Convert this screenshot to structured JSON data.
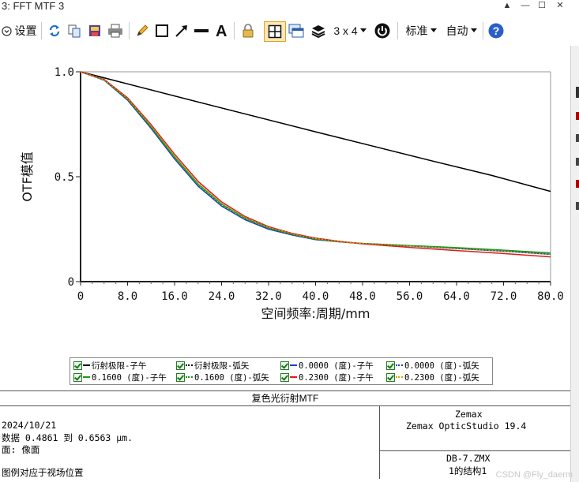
{
  "window": {
    "title": "3: FFT MTF 3",
    "controls": [
      "▲",
      "—",
      "☐",
      "✕"
    ]
  },
  "toolbar": {
    "settings_label": "设置",
    "layout_label": "3 x 4",
    "standard_label": "标准",
    "auto_label": "自动"
  },
  "chart_data": {
    "type": "line",
    "xlabel": "空间频率:周期/mm",
    "ylabel": "OTF模值",
    "xlim": [
      0,
      80
    ],
    "ylim": [
      0,
      1.0
    ],
    "xticks": [
      "0",
      "8.0",
      "16.0",
      "24.0",
      "32.0",
      "40.0",
      "48.0",
      "56.0",
      "64.0",
      "72.0",
      "80.0"
    ],
    "yticks": [
      "0",
      "0.5",
      "1.0"
    ],
    "grid": false,
    "legend_position": "bottom",
    "series": [
      {
        "name": "衍射极限-子午",
        "color": "#000000",
        "dash": "solid",
        "x": [
          0,
          10,
          20,
          30,
          40,
          50,
          60,
          70,
          80
        ],
        "y": [
          1.0,
          0.928,
          0.856,
          0.785,
          0.714,
          0.644,
          0.574,
          0.506,
          0.43
        ]
      },
      {
        "name": "衍射极限-弧矢",
        "color": "#000000",
        "dash": "dotted",
        "x": [
          0,
          10,
          20,
          30,
          40,
          50,
          60,
          70,
          80
        ],
        "y": [
          1.0,
          0.928,
          0.856,
          0.785,
          0.714,
          0.644,
          0.574,
          0.506,
          0.43
        ]
      },
      {
        "name": "0.0000 (度)-子午",
        "color": "#1f3fbf",
        "dash": "solid",
        "x": [
          0,
          4,
          8,
          12,
          16,
          20,
          24,
          28,
          32,
          36,
          40,
          44,
          48,
          56,
          64,
          72,
          80
        ],
        "y": [
          1.0,
          0.96,
          0.865,
          0.73,
          0.585,
          0.455,
          0.36,
          0.295,
          0.25,
          0.222,
          0.2,
          0.19,
          0.182,
          0.17,
          0.158,
          0.145,
          0.13
        ]
      },
      {
        "name": "0.0000 (度)-弧矢",
        "color": "#1f3fbf",
        "dash": "dotted",
        "x": [
          0,
          4,
          8,
          12,
          16,
          20,
          24,
          28,
          32,
          36,
          40,
          44,
          48,
          56,
          64,
          72,
          80
        ],
        "y": [
          1.0,
          0.96,
          0.865,
          0.73,
          0.585,
          0.455,
          0.36,
          0.295,
          0.25,
          0.222,
          0.2,
          0.19,
          0.182,
          0.17,
          0.158,
          0.145,
          0.13
        ]
      },
      {
        "name": "0.1600 (度)-子午",
        "color": "#1a9a1a",
        "dash": "solid",
        "x": [
          0,
          4,
          8,
          12,
          16,
          20,
          24,
          28,
          32,
          36,
          40,
          44,
          48,
          56,
          64,
          72,
          80
        ],
        "y": [
          1.0,
          0.962,
          0.87,
          0.738,
          0.595,
          0.465,
          0.37,
          0.303,
          0.257,
          0.226,
          0.203,
          0.19,
          0.182,
          0.172,
          0.162,
          0.15,
          0.137
        ]
      },
      {
        "name": "0.1600 (度)-弧矢",
        "color": "#1a9a1a",
        "dash": "dotted",
        "x": [
          0,
          4,
          8,
          12,
          16,
          20,
          24,
          28,
          32,
          36,
          40,
          44,
          48,
          56,
          64,
          72,
          80
        ],
        "y": [
          1.0,
          0.961,
          0.868,
          0.735,
          0.59,
          0.46,
          0.366,
          0.3,
          0.254,
          0.224,
          0.202,
          0.19,
          0.182,
          0.171,
          0.16,
          0.148,
          0.134
        ]
      },
      {
        "name": "0.2300 (度)-子午",
        "color": "#dd1a1a",
        "dash": "solid",
        "x": [
          0,
          4,
          8,
          12,
          16,
          20,
          24,
          28,
          32,
          36,
          40,
          44,
          48,
          56,
          64,
          72,
          80
        ],
        "y": [
          1.0,
          0.964,
          0.876,
          0.748,
          0.607,
          0.478,
          0.38,
          0.31,
          0.262,
          0.23,
          0.207,
          0.192,
          0.18,
          0.163,
          0.148,
          0.134,
          0.118
        ]
      },
      {
        "name": "0.2300 (度)-弧矢",
        "color": "#d4a800",
        "dash": "dotted",
        "x": [
          0,
          4,
          8,
          12,
          16,
          20,
          24,
          28,
          32,
          36,
          40,
          44,
          48,
          56,
          64,
          72,
          80
        ],
        "y": [
          1.0,
          0.963,
          0.872,
          0.742,
          0.6,
          0.47,
          0.374,
          0.306,
          0.259,
          0.228,
          0.205,
          0.191,
          0.182,
          0.17,
          0.158,
          0.145,
          0.13
        ]
      }
    ]
  },
  "legend": [
    {
      "label": "衍射极限-子午",
      "color": "#000000",
      "dash": "solid"
    },
    {
      "label": "衍射极限-弧矢",
      "color": "#000000",
      "dash": "dotted"
    },
    {
      "label": "0.0000 (度)-子午",
      "color": "#1f3fbf",
      "dash": "solid"
    },
    {
      "label": "0.0000 (度)-弧矢",
      "color": "#1f3fbf",
      "dash": "dotted"
    },
    {
      "label": "0.1600 (度)-子午",
      "color": "#1a9a1a",
      "dash": "solid"
    },
    {
      "label": "0.1600 (度)-弧矢",
      "color": "#1a9a1a",
      "dash": "dotted"
    },
    {
      "label": "0.2300 (度)-子午",
      "color": "#dd1a1a",
      "dash": "solid"
    },
    {
      "label": "0.2300 (度)-弧矢",
      "color": "#d4a800",
      "dash": "dotted"
    }
  ],
  "info": {
    "title": "复色光衍射MTF",
    "date": "2024/10/21",
    "data_range": "数据 0.4861 到 0.6563 µm.",
    "surface": "面: 像面",
    "legend_note": "图例对应于视场位置",
    "company": "Zemax",
    "software": "Zemax OpticStudio 19.4",
    "file": "DB-7.ZMX",
    "config": "1的结构1"
  },
  "watermark": "CSDN @Fly_daerm"
}
